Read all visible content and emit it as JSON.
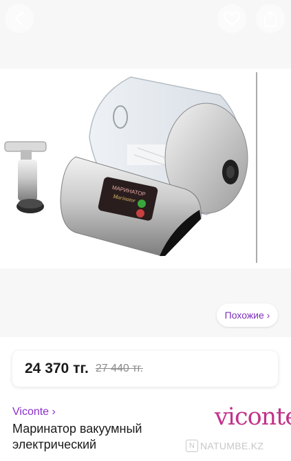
{
  "header": {
    "back_icon": "chevron-left-icon",
    "favorite_icon": "heart-icon",
    "share_icon": "share-icon"
  },
  "product_image": {
    "description_icon": "vacuum-marinator-product-photo",
    "device_label_line1": "МАРИНАТОР",
    "device_label_line2": "Marinator",
    "indicator_on": "ON",
    "indicator_off": "OFF"
  },
  "similar": {
    "label": "Похожие ›"
  },
  "price": {
    "current": "24 370 тг.",
    "old": "27 440 тг."
  },
  "product": {
    "brand": "Viconte ›",
    "title": "Маринатор вакуумный электрический"
  },
  "brand_logo": {
    "text": "viconte",
    "color": "#c2328a"
  },
  "watermark": {
    "icon_letter": "N",
    "text": "NATUMBE.KZ"
  },
  "colors": {
    "accent": "#8b2fc9"
  }
}
